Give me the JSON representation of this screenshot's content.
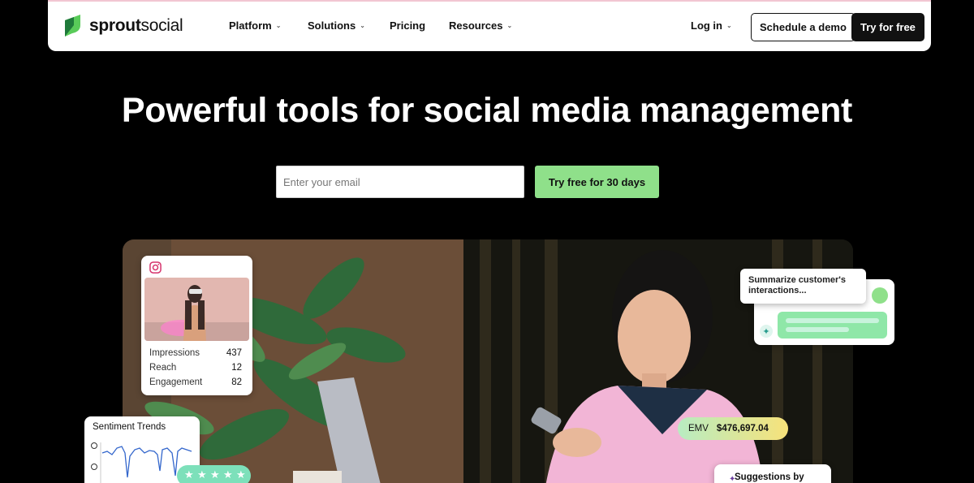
{
  "brand": {
    "name_part1": "sprout",
    "name_part2": "social",
    "accent": "#59cb59"
  },
  "nav": {
    "items": [
      {
        "label": "Platform",
        "has_dropdown": true
      },
      {
        "label": "Solutions",
        "has_dropdown": true
      },
      {
        "label": "Pricing",
        "has_dropdown": false
      },
      {
        "label": "Resources",
        "has_dropdown": true
      }
    ],
    "login": "Log in",
    "schedule_demo": "Schedule a demo",
    "try_free": "Try for free"
  },
  "hero": {
    "title": "Powerful tools for social media management",
    "email_placeholder": "Enter your email",
    "cta": "Try free for 30 days"
  },
  "instagram_card": {
    "icon": "instagram-icon",
    "metrics": [
      {
        "label": "Impressions",
        "value": "437"
      },
      {
        "label": "Reach",
        "value": "12"
      },
      {
        "label": "Engagement",
        "value": "82"
      }
    ]
  },
  "sentiment": {
    "title": "Sentiment Trends",
    "rating_stars": 5
  },
  "ai": {
    "prompt": "Summarize customer's interactions..."
  },
  "emv": {
    "label": "EMV",
    "value": "$476,697.04"
  },
  "suggestions": {
    "label": "Suggestions by"
  }
}
